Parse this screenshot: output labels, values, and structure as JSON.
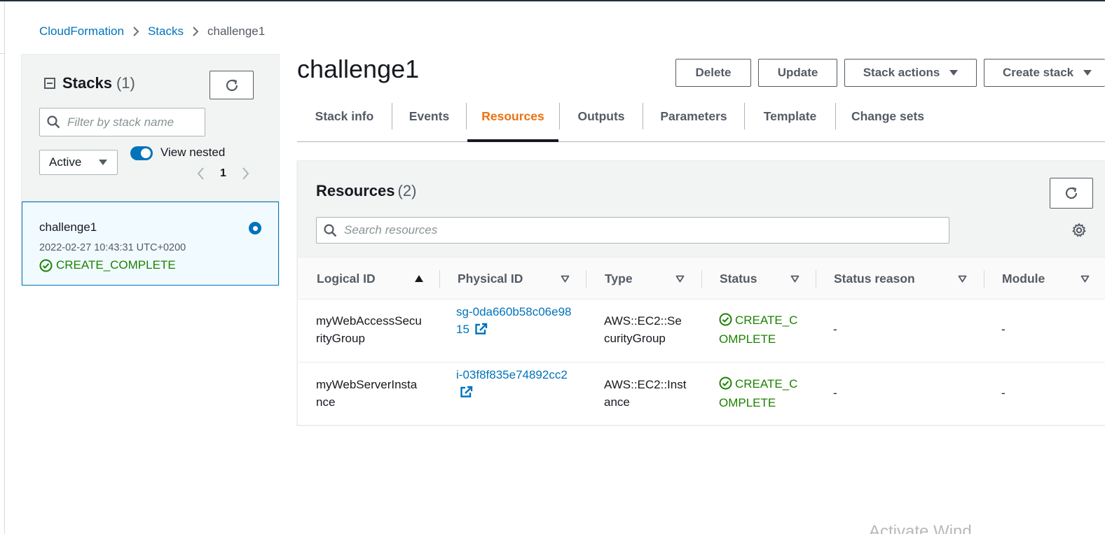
{
  "breadcrumb": {
    "items": [
      "CloudFormation",
      "Stacks"
    ],
    "current": "challenge1"
  },
  "sidebar": {
    "title": "Stacks",
    "count": "(1)",
    "filter_placeholder": "Filter by stack name",
    "status_filter": "Active",
    "view_nested_label": "View nested",
    "view_nested_on": true,
    "page": "1",
    "stacks": [
      {
        "name": "challenge1",
        "time": "2022-02-27 10:43:31 UTC+0200",
        "status": "CREATE_COMPLETE",
        "selected": true
      }
    ]
  },
  "main": {
    "title": "challenge1",
    "buttons": {
      "delete": "Delete",
      "update": "Update",
      "stack_actions": "Stack actions",
      "create_stack": "Create stack"
    },
    "tabs": [
      "Stack info",
      "Events",
      "Resources",
      "Outputs",
      "Parameters",
      "Template",
      "Change sets"
    ],
    "active_tab": "Resources"
  },
  "resources": {
    "title": "Resources",
    "count": "(2)",
    "search_placeholder": "Search resources",
    "columns": [
      "Logical ID",
      "Physical ID",
      "Type",
      "Status",
      "Status reason",
      "Module"
    ],
    "rows": [
      {
        "logical_id": "myWebAccessSecurityGroup",
        "physical_id": "sg-0da660b58c06e9815",
        "type": "AWS::EC2::SecurityGroup",
        "status": "CREATE_COMPLETE",
        "status_reason": "-",
        "module": "-"
      },
      {
        "logical_id": "myWebServerInstance",
        "physical_id": "i-03f8f835e74892cc2",
        "type": "AWS::EC2::Instance",
        "status": "CREATE_COMPLETE",
        "status_reason": "-",
        "module": "-"
      }
    ]
  },
  "colors": {
    "link": "#0073bb",
    "active_tab": "#ec7211",
    "success": "#1d8102",
    "selected_bg": "#f1faff"
  },
  "watermark": "Activate Wind"
}
